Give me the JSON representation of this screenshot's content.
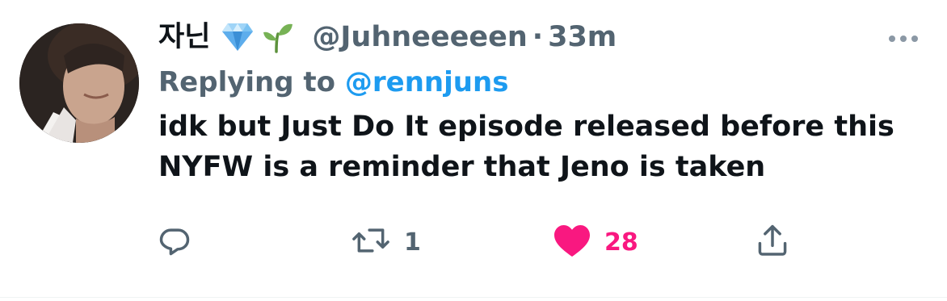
{
  "tweet": {
    "display_name": "자닌",
    "badges": [
      "gem-icon",
      "seedling-icon"
    ],
    "handle": "@Juhneeeeen",
    "separator": "·",
    "time": "33m",
    "replying_prefix": "Replying to",
    "replying_to": "@rennjuns",
    "text": "idk but Just Do It episode released before this NYFW is a reminder that Jeno is taken"
  },
  "actions": {
    "reply": {
      "icon": "reply-icon"
    },
    "retweet": {
      "icon": "retweet-icon",
      "count": "1"
    },
    "like": {
      "icon": "heart-icon",
      "count": "28",
      "liked": true
    },
    "share": {
      "icon": "share-icon"
    }
  },
  "colors": {
    "text": "#0f1419",
    "secondary": "#536471",
    "link": "#1d9bf0",
    "like": "#f91880"
  }
}
